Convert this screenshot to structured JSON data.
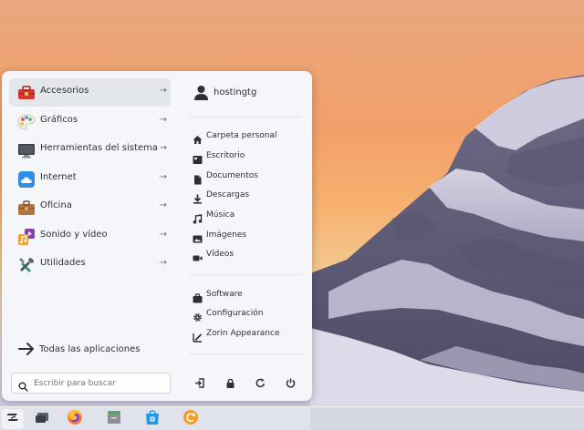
{
  "menu": {
    "categories": [
      {
        "label": "Accesorios",
        "icon": "toolbox-icon",
        "selected": true
      },
      {
        "label": "Gráficos",
        "icon": "palette-icon"
      },
      {
        "label": "Herramientas del sistema",
        "icon": "monitor-icon"
      },
      {
        "label": "Internet",
        "icon": "cloud-icon"
      },
      {
        "label": "Oficina",
        "icon": "briefcase-icon"
      },
      {
        "label": "Sonido y vídeo",
        "icon": "music-video-icon"
      },
      {
        "label": "Utilidades",
        "icon": "utilities-icon"
      }
    ],
    "arrow": "→",
    "all_apps_label": "Todas las aplicaciones",
    "search_placeholder": "Escribir para buscar",
    "user_name": "hostingtg",
    "places": [
      {
        "label": "Carpeta personal",
        "icon": "home-icon"
      },
      {
        "label": "Escritorio",
        "icon": "desktop-icon"
      },
      {
        "label": "Documentos",
        "icon": "document-icon"
      },
      {
        "label": "Descargas",
        "icon": "download-icon"
      },
      {
        "label": "Música",
        "icon": "music-icon"
      },
      {
        "label": "Imágenes",
        "icon": "image-icon"
      },
      {
        "label": "Vídeos",
        "icon": "video-icon"
      }
    ],
    "system": [
      {
        "label": "Software",
        "icon": "software-icon"
      },
      {
        "label": "Configuración",
        "icon": "settings-icon"
      },
      {
        "label": "Zorin Appearance",
        "icon": "appearance-icon"
      }
    ],
    "power_actions": [
      "logout-icon",
      "lock-icon",
      "restart-icon",
      "power-icon"
    ]
  },
  "taskbar": {
    "items": [
      "zorin-menu-icon",
      "workspace-icon",
      "firefox-icon",
      "files-icon",
      "software-store-icon",
      "updates-icon"
    ]
  },
  "colors": {
    "accent_red": "#d9383a",
    "text": "#2d3035",
    "menu_bg": "#f4f6f9"
  }
}
